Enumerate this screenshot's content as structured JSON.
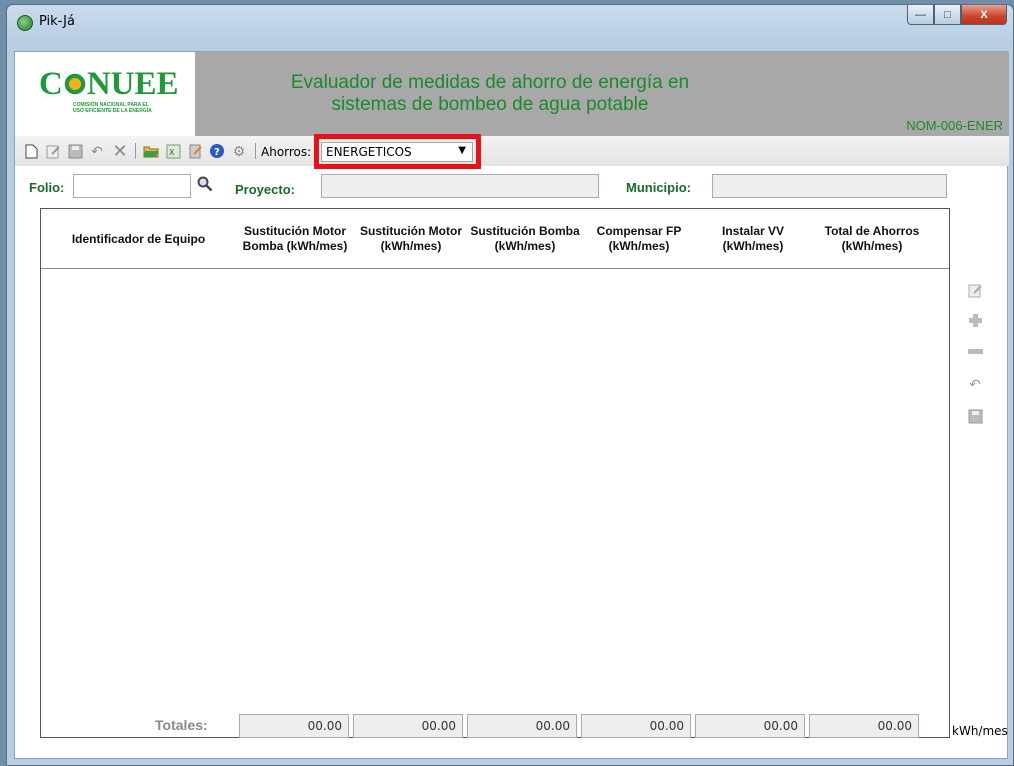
{
  "window": {
    "title": "Pik-Já",
    "minimize_label": "—",
    "maximize_label": "□",
    "close_label": "X"
  },
  "header": {
    "logo_text": "CONUEE",
    "logo_sub": "Comisión Nacional para el Uso Eficiente de la Energía",
    "title_line1": "Evaluador de medidas de ahorro de energía en",
    "title_line2": "sistemas de bombeo de agua potable",
    "norm": "NOM-006-ENER"
  },
  "toolbar": {
    "ahorros_label": "Ahorros:",
    "ahorros_value": "ENERGETICOS",
    "icons": [
      "new-icon",
      "edit-icon",
      "save-icon",
      "undo-icon",
      "delete-icon",
      "open-folder-icon",
      "excel-icon",
      "report-icon",
      "help-icon",
      "settings-icon"
    ]
  },
  "fields": {
    "folio_label": "Folio:",
    "folio_value": "",
    "proyecto_label": "Proyecto:",
    "proyecto_value": "",
    "municipio_label": "Municipio:",
    "municipio_value": ""
  },
  "grid": {
    "columns": [
      "Identificador de Equipo",
      "Sustitución Motor Bomba (kWh/mes)",
      "Sustitución Motor (kWh/mes)",
      "Sustitución Bomba (kWh/mes)",
      "Compensar FP (kWh/mes)",
      "Instalar VV (kWh/mes)",
      "Total de Ahorros (kWh/mes)"
    ],
    "rows": []
  },
  "side_icons": [
    "edit-row-icon",
    "add-row-icon",
    "remove-row-icon",
    "undo-row-icon",
    "save-row-icon"
  ],
  "totals": {
    "label": "Totales:",
    "values": [
      "00.00",
      "00.00",
      "00.00",
      "00.00",
      "00.00",
      "00.00"
    ],
    "unit": "kWh/mes"
  },
  "colors": {
    "accent_green": "#1a8a2a",
    "header_gray": "#a8a8a8",
    "highlight_red": "#e8101a"
  }
}
